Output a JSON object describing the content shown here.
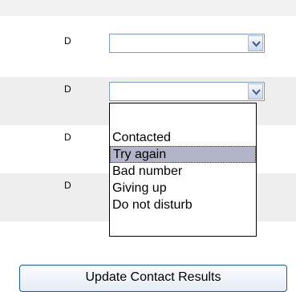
{
  "rows": [
    {
      "code": "D"
    },
    {
      "code": "D"
    },
    {
      "code": "D"
    },
    {
      "code": "D"
    }
  ],
  "dropdown": {
    "options": [
      "Contacted",
      "Try again",
      "Bad number",
      "Giving up",
      "Do not disturb"
    ],
    "highlighted": "Try again"
  },
  "update_button_label": "Update Contact Results",
  "icons": {
    "dropdown_arrow": "chevron-down-icon"
  }
}
